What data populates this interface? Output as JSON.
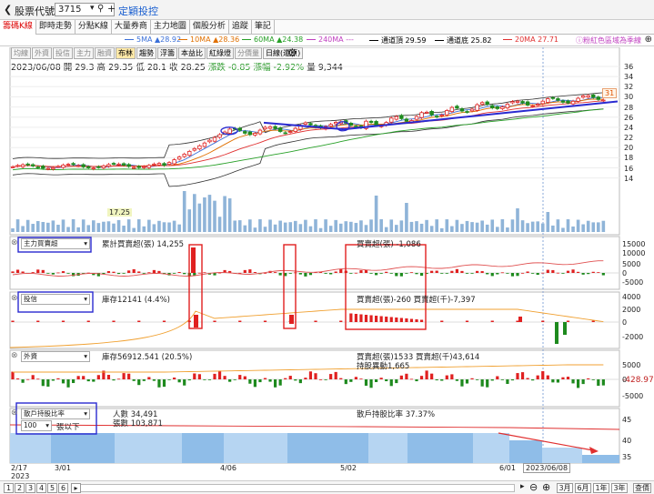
{
  "topbar": {
    "back_glyph": "❮",
    "label": "股票代號",
    "code_value": "3715",
    "title": "定穎投控"
  },
  "tabs": [
    "籌碼K線",
    "即時走勢",
    "分點K線",
    "大量券商",
    "主力地圖",
    "個股分析",
    "追蹤",
    "筆記"
  ],
  "ma_legend": [
    {
      "label": "5MA ▲28.92",
      "color": "#3a6fd8"
    },
    {
      "label": "10MA ▲28.36",
      "color": "#e07000"
    },
    {
      "label": "60MA ▲24.38",
      "color": "#28a028"
    },
    {
      "label": "240MA ---",
      "color": "#c040c0"
    },
    {
      "label": "通道頂 29.59",
      "color": "#000000"
    },
    {
      "label": "通道底 25.82",
      "color": "#000000"
    },
    {
      "label": "20MA 27.71",
      "color": "#e03030"
    }
  ],
  "ma_note": "ⓘ粉紅色區域為季線",
  "toolbar": [
    "均線",
    "外資",
    "投信",
    "主力",
    "融資",
    "布林",
    "趨勢",
    "浮籌",
    "本益比",
    "紅綠燈",
    "分價量",
    "日線(還原)"
  ],
  "price_info": {
    "date": "2023/06/08",
    "open_label": "開",
    "open": "29.3",
    "high_label": "高",
    "high": "29.35",
    "low_label": "低",
    "low": "28.1",
    "close_label": "收",
    "close": "28.25",
    "chg_label": "漲跌",
    "chg": "-0.85",
    "pct_label": "漲幅",
    "pct": "-2.92%",
    "vol_label": "量",
    "vol": "9,344"
  },
  "main_y_ticks": [
    "36",
    "34",
    "32",
    "30",
    "28",
    "26",
    "24",
    "22",
    "20",
    "18",
    "16",
    "14"
  ],
  "low_label": "17.25",
  "last_price_tag": "31",
  "panel1": {
    "select": "主力買賣超",
    "legend1": "累計買賣超(張) 14,255",
    "legend2": "買賣超(張) -1,086",
    "ticks": [
      "15000",
      "10000",
      "5000",
      "0",
      "-5000"
    ]
  },
  "panel2": {
    "select": "投信",
    "legend1": "庫存12141 (4.4%)",
    "legend2": "買賣超(張)-260 買賣超(千)-7,397",
    "ticks": [
      "4000",
      "2000",
      "0",
      "-2000"
    ]
  },
  "panel3": {
    "select": "外資",
    "legend1": "庫存56912.541 (20.5%)",
    "legend2": "買賣超(張)1533 買賣超(千)43,614",
    "legend3": "持股異動1,665",
    "ticks": [
      "5000",
      "0",
      "-5000"
    ],
    "current": "-428.97"
  },
  "panel4": {
    "select": "散戶持股比率",
    "legend1": "人數 34,491",
    "legend2": "張數 103,871",
    "legend3": "散戶持股比率 37.37%",
    "sub_select": "100",
    "sub_label": "張以下",
    "ticks": [
      "45",
      "40",
      "35"
    ]
  },
  "x_labels": [
    "2/17",
    "2023",
    "3/01",
    "4/06",
    "5/02",
    "6/01"
  ],
  "crosshair_date": "2023/06/08",
  "bottom": {
    "pages": [
      "1",
      "2",
      "3",
      "4",
      "5",
      "6"
    ],
    "ranges": [
      "3月",
      "6月",
      "1年",
      "3年"
    ],
    "query": "查價"
  },
  "chart_data": {
    "type": "candlestick",
    "ylim": [
      13,
      37
    ],
    "ma_channel_colors": [
      "#3a6fd8",
      "#e07000",
      "#28a028",
      "#e03030",
      "#000000"
    ]
  }
}
